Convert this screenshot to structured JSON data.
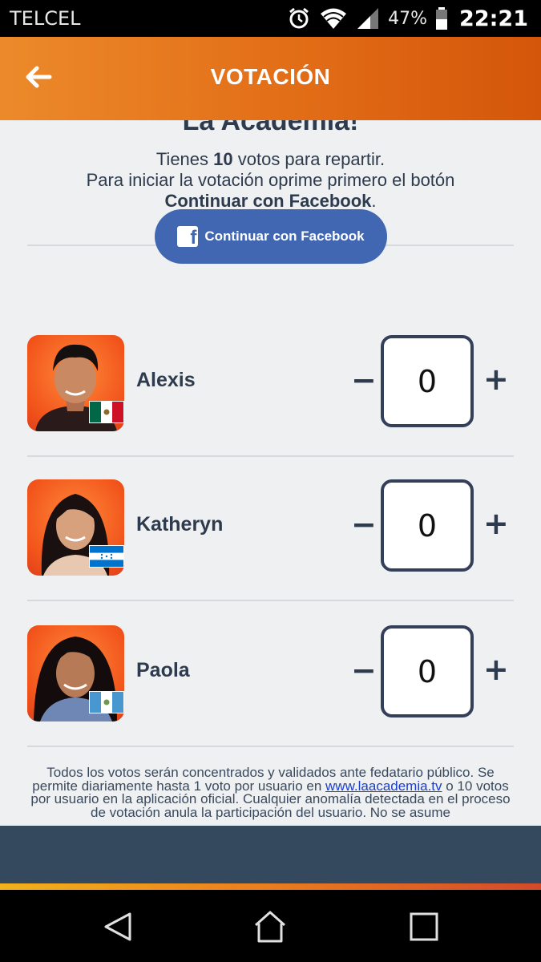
{
  "status_bar": {
    "carrier": "TELCEL",
    "battery_percent": "47%",
    "time": "22:21",
    "icons": [
      "alarm-icon",
      "wifi-icon",
      "signal-icon",
      "battery-icon"
    ]
  },
  "app_bar": {
    "title": "VOTACIÓN",
    "back_icon": "arrow-left-icon"
  },
  "intro": {
    "cut_heading": "La Academia!",
    "line1_pre": "Tienes ",
    "votes": "10",
    "line1_post": " votos para repartir.",
    "line2": "Para iniciar la votación oprime primero el botón",
    "line3_bold": "Continuar con Facebook",
    "line3_end": "."
  },
  "facebook_button": {
    "label": "Continuar con Facebook",
    "color": "#4267b2"
  },
  "candidates": [
    {
      "name": "Alexis",
      "votes": "0",
      "flag": "mexico-flag-icon"
    },
    {
      "name": "Katheryn",
      "votes": "0",
      "flag": "honduras-flag-icon"
    },
    {
      "name": "Paola",
      "votes": "0",
      "flag": "guatemala-flag-icon"
    }
  ],
  "controls": {
    "minus": "−",
    "plus": "+"
  },
  "legal": {
    "text_pre": "Todos los votos serán concentrados y validados ante fedatario público. Se permite diariamente hasta 1 voto por usuario en ",
    "link": "www.laacademia.tv",
    "text_post": " o 10 votos por usuario en la aplicación oficial. Cualquier anomalía detectada en el proceso de votación anula la participación del usuario. No se asume"
  },
  "colors": {
    "app_bar_start": "#ec8a2a",
    "app_bar_end": "#d4560a",
    "text_dark": "#2e3b4e",
    "footer": "#34495e"
  },
  "nav_bar": [
    "back-triangle-icon",
    "home-icon",
    "recents-square-icon"
  ]
}
